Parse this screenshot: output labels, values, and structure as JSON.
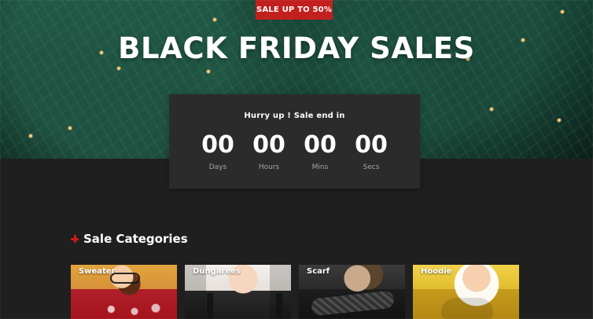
{
  "hero": {
    "badge": "SALE UP TO 50%",
    "title": "BLACK FRIDAY SALES"
  },
  "countdown": {
    "title": "Hurry up ! Sale end in",
    "units": [
      {
        "value": "00",
        "label": "Days"
      },
      {
        "value": "00",
        "label": "Hours"
      },
      {
        "value": "00",
        "label": "Mins"
      },
      {
        "value": "00",
        "label": "Secs"
      }
    ]
  },
  "sale_categories": {
    "title": "Sale Categories",
    "items": [
      {
        "label": "Sweater"
      },
      {
        "label": "Dungarees"
      },
      {
        "label": "Scarf"
      },
      {
        "label": "Hoodie"
      }
    ]
  },
  "colors": {
    "accent_red": "#c21f1f",
    "background_dark": "#1f1f1f",
    "countdown_bg": "#2b2b2b"
  },
  "icons": {
    "plus_icon": "plus-icon"
  }
}
